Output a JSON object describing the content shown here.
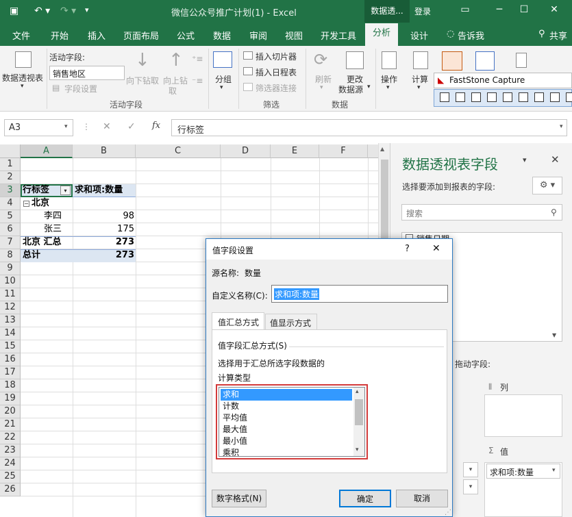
{
  "titlebar": {
    "doc_title": "微信公众号推广计划(1)  -  Excel",
    "context_label": "数据透...",
    "login": "登录"
  },
  "tabs": [
    "文件",
    "开始",
    "插入",
    "页面布局",
    "公式",
    "数据",
    "审阅",
    "视图",
    "开发工具",
    "分析",
    "设计",
    "告诉我",
    "共享"
  ],
  "ribbon": {
    "pivot_table": "数据透视表",
    "active_field_label": "活动字段:",
    "active_field_value": "销售地区",
    "field_settings": "字段设置",
    "drill_down": "向下钻取",
    "drill_up_1": "向上钻",
    "drill_up_2": "取",
    "group_active_field": "活动字段",
    "group": "分组",
    "insert_slicer": "插入切片器",
    "insert_timeline": "插入日程表",
    "filter_connections": "筛选器连接",
    "group_filter": "筛选",
    "refresh": "刷新",
    "change_source_1": "更改",
    "change_source_2": "数据源",
    "group_data": "数据",
    "actions": "操作",
    "calculations": "计算",
    "faststone": "FastStone Capture"
  },
  "formula_bar": {
    "name_box": "A3",
    "formula": "行标签",
    "fx": "fx"
  },
  "sheet": {
    "columns": [
      "A",
      "B",
      "C",
      "D",
      "E",
      "F"
    ],
    "rows": [
      "1",
      "2",
      "3",
      "4",
      "5",
      "6",
      "7",
      "8",
      "9",
      "10",
      "11",
      "12",
      "13",
      "14",
      "15",
      "16",
      "17",
      "18",
      "19",
      "20",
      "21",
      "22",
      "23",
      "24",
      "25",
      "26"
    ],
    "header_a": "行标签",
    "header_b": "求和项:数量",
    "r4_a": "北京",
    "r5_a": "李四",
    "r5_b": "98",
    "r6_a": "张三",
    "r6_b": "175",
    "r7_a": "北京 汇总",
    "r7_b": "273",
    "r8_a": "总计",
    "r8_b": "273"
  },
  "pane": {
    "title": "数据透视表字段",
    "subtitle": "选择要添加到报表的字段:",
    "search_placeholder": "搜索",
    "field_1": "销售日期",
    "drag_hint": "拖动字段:",
    "columns_label": "列",
    "values_label": "值",
    "values_item": "求和项:数量"
  },
  "dialog": {
    "title": "值字段设置",
    "help": "?",
    "close": "✕",
    "source_label": "源名称:",
    "source_value": "数量",
    "custom_label": "自定义名称(C):",
    "custom_value": "求和项:数量",
    "tab_summarize": "值汇总方式",
    "tab_show_as": "值显示方式",
    "section": "值字段汇总方式(S)",
    "desc_1": "选择用于汇总所选字段数据的",
    "desc_2": "计算类型",
    "list": [
      "求和",
      "计数",
      "平均值",
      "最大值",
      "最小值",
      "乘积"
    ],
    "number_format": "数字格式(N)",
    "ok": "确定",
    "cancel": "取消"
  },
  "colors": {
    "accent": "#217346",
    "selection": "#3399ff",
    "highlight_box": "#d33a3a"
  }
}
